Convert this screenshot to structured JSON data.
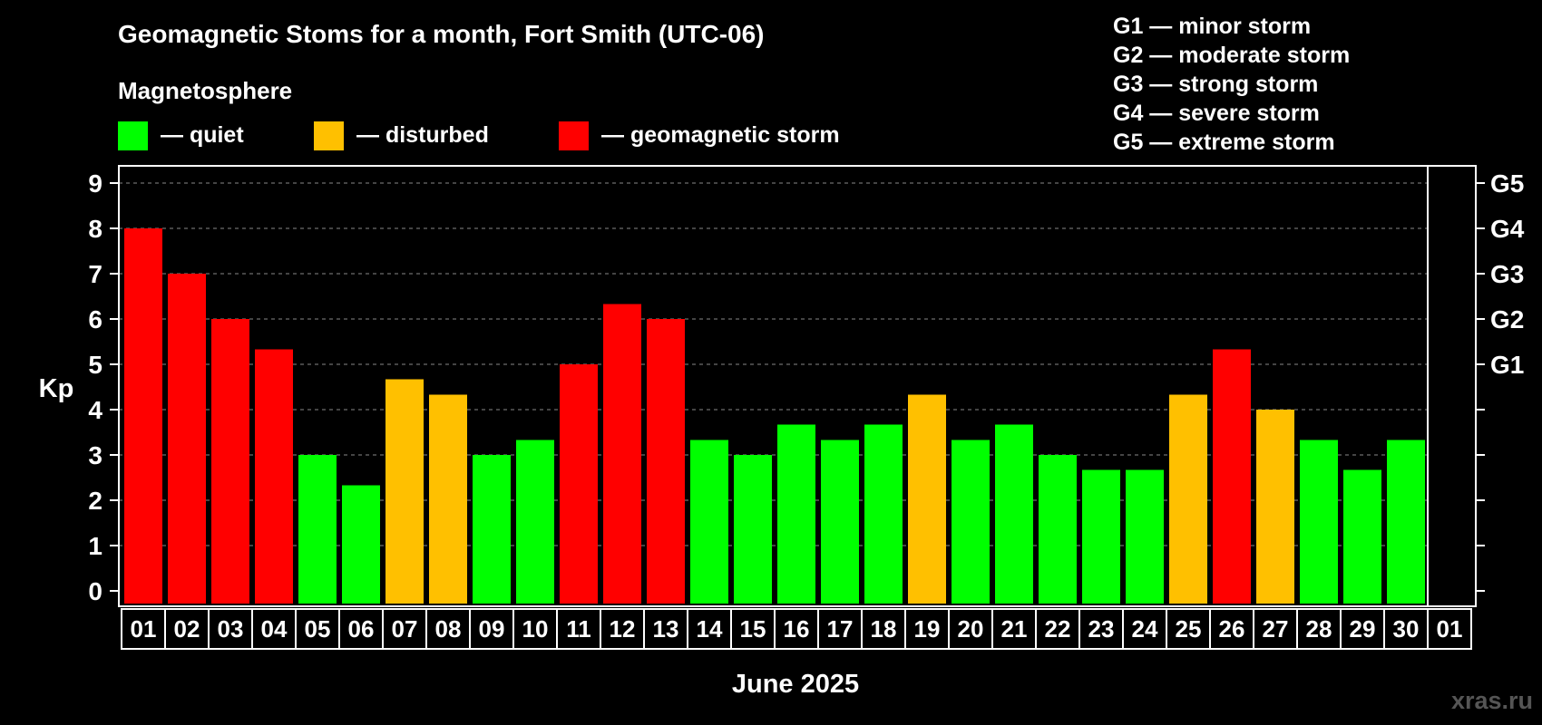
{
  "chart_data": {
    "type": "bar",
    "title": "Geomagnetic Stoms for a month, Fort Smith (UTC-06)",
    "subtitle": "Magnetosphere",
    "legend": [
      {
        "label": "— quiet",
        "color": "#00ff00"
      },
      {
        "label": "— disturbed",
        "color": "#ffc000"
      },
      {
        "label": "— geomagnetic storm",
        "color": "#ff0000"
      }
    ],
    "storm_scale": [
      "G1 — minor storm",
      "G2 — moderate storm",
      "G3 — strong storm",
      "G4 — severe storm",
      "G5 — extreme storm"
    ],
    "ylabel": "Kp",
    "xlabel": "June 2025",
    "ylim": [
      0,
      9
    ],
    "yticks": [
      "0",
      "1",
      "2",
      "3",
      "4",
      "5",
      "6",
      "7",
      "8",
      "9"
    ],
    "right_axis": [
      {
        "label": "G1",
        "kp": 5
      },
      {
        "label": "G2",
        "kp": 6
      },
      {
        "label": "G3",
        "kp": 7
      },
      {
        "label": "G4",
        "kp": 8
      },
      {
        "label": "G5",
        "kp": 9
      }
    ],
    "categories": [
      "01",
      "02",
      "03",
      "04",
      "05",
      "06",
      "07",
      "08",
      "09",
      "10",
      "11",
      "12",
      "13",
      "14",
      "15",
      "16",
      "17",
      "18",
      "19",
      "20",
      "21",
      "22",
      "23",
      "24",
      "25",
      "26",
      "27",
      "28",
      "29",
      "30",
      "01"
    ],
    "values": [
      8.0,
      7.0,
      6.0,
      5.33,
      3.0,
      2.33,
      4.67,
      4.33,
      3.0,
      3.33,
      5.0,
      6.33,
      6.0,
      3.33,
      3.0,
      3.67,
      3.33,
      3.67,
      4.33,
      3.33,
      3.67,
      3.0,
      2.67,
      2.67,
      4.33,
      5.33,
      4.0,
      3.33,
      2.67,
      3.33,
      null
    ],
    "levels": [
      "storm",
      "storm",
      "storm",
      "storm",
      "quiet",
      "quiet",
      "disturbed",
      "disturbed",
      "quiet",
      "quiet",
      "storm",
      "storm",
      "storm",
      "quiet",
      "quiet",
      "quiet",
      "quiet",
      "quiet",
      "disturbed",
      "quiet",
      "quiet",
      "quiet",
      "quiet",
      "quiet",
      "disturbed",
      "storm",
      "disturbed",
      "quiet",
      "quiet",
      "quiet",
      null
    ],
    "colors": {
      "quiet": "#00ff00",
      "disturbed": "#ffc000",
      "storm": "#ff0000"
    },
    "grid": true
  },
  "watermark": "xras.ru"
}
